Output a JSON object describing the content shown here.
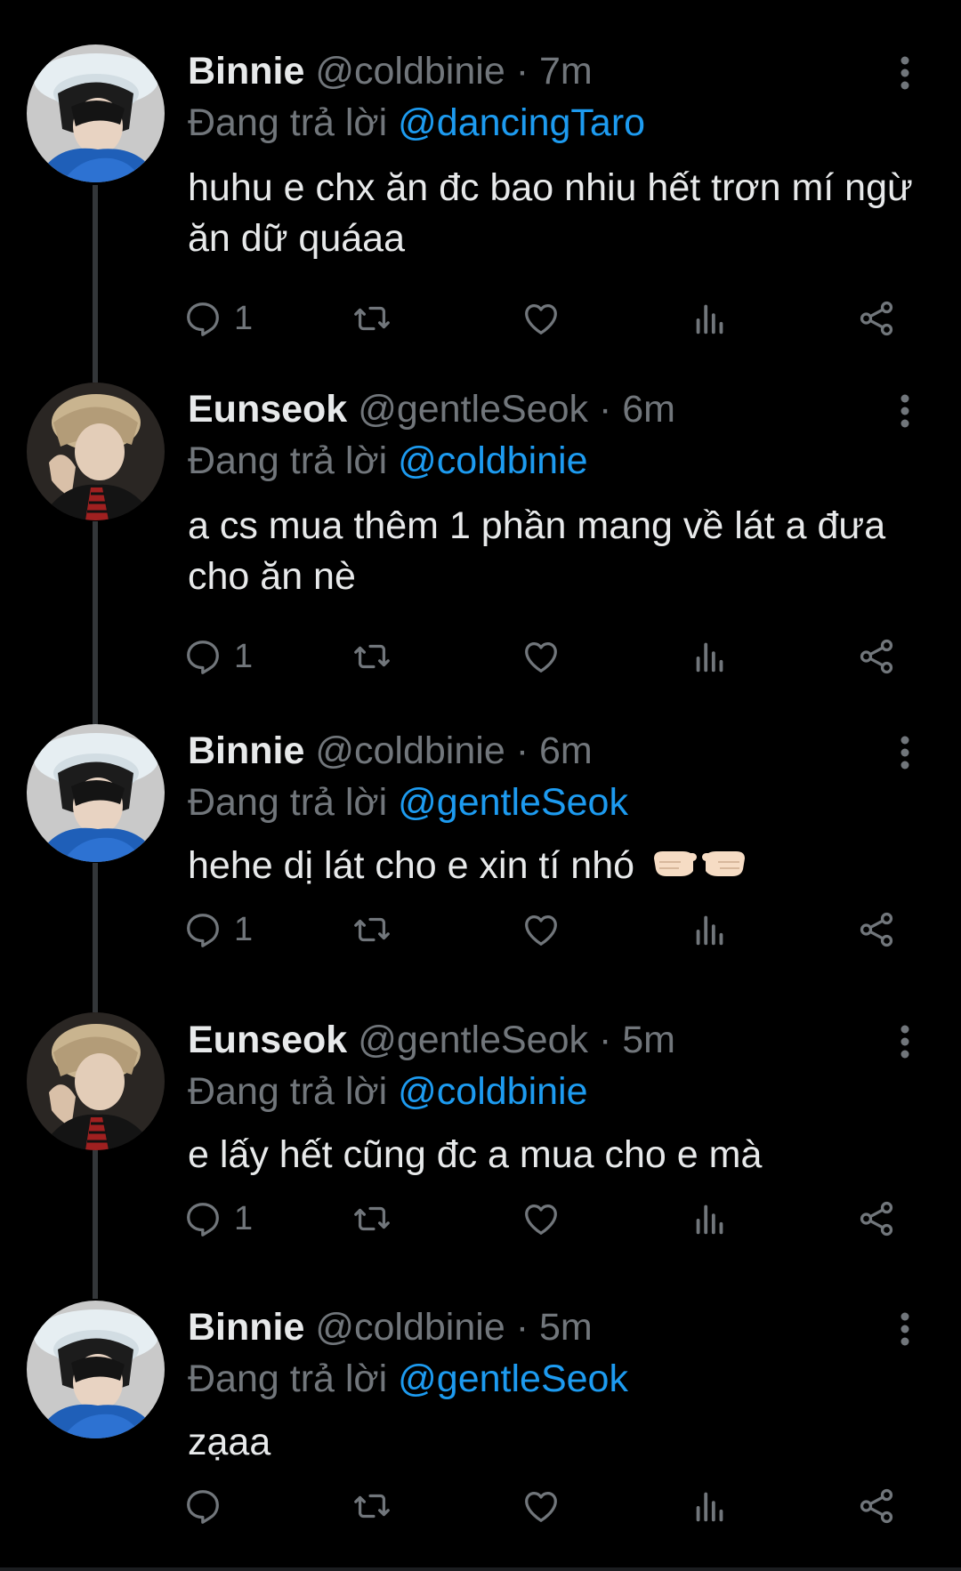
{
  "colors": {
    "background": "#000000",
    "text": "#e7e9ea",
    "muted": "#71767b",
    "accent": "#1d9bf0",
    "thread_line": "#333639"
  },
  "reply_prefix": "Đang trả lời",
  "tweets": [
    {
      "name": "Binnie",
      "handle": "@coldbinie",
      "time": "7m",
      "reply_to": "@dancingTaro",
      "text": "huhu e chx ăn đc bao nhiu hết trơn mí ngừ ăn dữ quáaa",
      "reply_count": "1",
      "avatar": "binnie-avatar"
    },
    {
      "name": "Eunseok",
      "handle": "@gentleSeok",
      "time": "6m",
      "reply_to": "@coldbinie",
      "text": "a cs mua thêm 1 phần mang về lát a đưa cho ăn nè",
      "reply_count": "1",
      "avatar": "eunseok-avatar"
    },
    {
      "name": "Binnie",
      "handle": "@coldbinie",
      "time": "6m",
      "reply_to": "@gentleSeok",
      "text": "hehe dị lát cho e xin tí nhó",
      "emoji": "pointing-fingers-emoji",
      "reply_count": "1",
      "avatar": "binnie-avatar"
    },
    {
      "name": "Eunseok",
      "handle": "@gentleSeok",
      "time": "5m",
      "reply_to": "@coldbinie",
      "text": "e lấy hết cũng đc a mua cho e mà",
      "reply_count": "1",
      "avatar": "eunseok-avatar"
    },
    {
      "name": "Binnie",
      "handle": "@coldbinie",
      "time": "5m",
      "reply_to": "@gentleSeok",
      "text": "zạaa",
      "reply_count": "",
      "avatar": "binnie-avatar"
    }
  ],
  "icons": {
    "reply": "reply-icon",
    "retweet": "retweet-icon",
    "like": "like-icon",
    "views": "views-icon",
    "share": "share-icon",
    "more": "more-options-icon"
  }
}
